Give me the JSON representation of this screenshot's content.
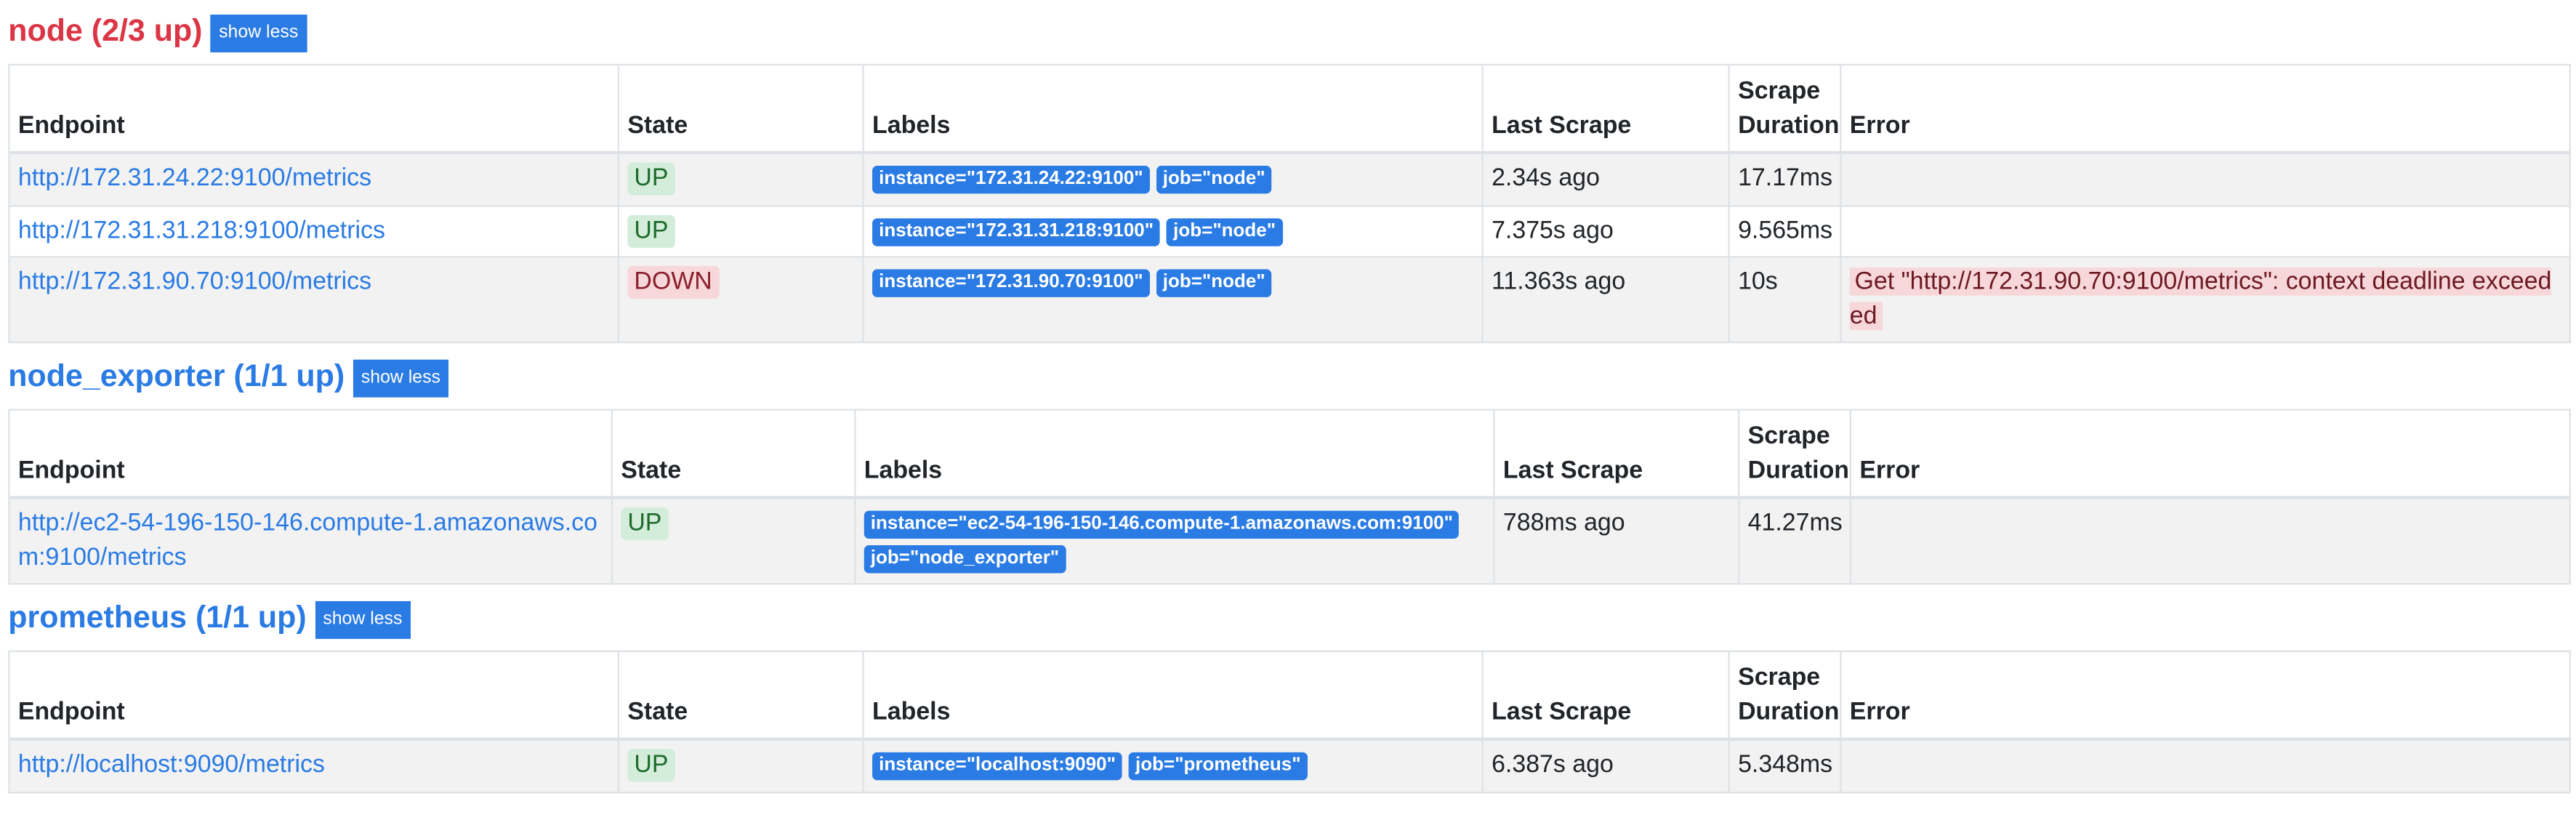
{
  "headers": {
    "endpoint": "Endpoint",
    "state": "State",
    "labels": "Labels",
    "last_scrape": "Last Scrape",
    "scrape_duration": "Scrape Duration",
    "error": "Error"
  },
  "jobs": [
    {
      "title": "node (2/3 up)",
      "button": "show less",
      "rows": [
        {
          "endpoint": "http://172.31.24.22:9100/metrics",
          "state": "UP",
          "labels": [
            "instance=\"172.31.24.22:9100\"",
            "job=\"node\""
          ],
          "last_scrape": "2.34s ago",
          "duration": "17.17ms",
          "error": ""
        },
        {
          "endpoint": "http://172.31.31.218:9100/metrics",
          "state": "UP",
          "labels": [
            "instance=\"172.31.31.218:9100\"",
            "job=\"node\""
          ],
          "last_scrape": "7.375s ago",
          "duration": "9.565ms",
          "error": ""
        },
        {
          "endpoint": "http://172.31.90.70:9100/metrics",
          "state": "DOWN",
          "labels": [
            "instance=\"172.31.90.70:9100\"",
            "job=\"node\""
          ],
          "last_scrape": "11.363s ago",
          "duration": "10s",
          "error": "Get \"http://172.31.90.70:9100/metrics\": context deadline exceeded"
        }
      ]
    },
    {
      "title": "node_exporter (1/1 up)",
      "button": "show less",
      "rows": [
        {
          "endpoint": "http://ec2-54-196-150-146.compute-1.amazonaws.com:9100/metrics",
          "state": "UP",
          "labels": [
            "instance=\"ec2-54-196-150-146.compute-1.amazonaws.com:9100\"",
            "job=\"node_exporter\""
          ],
          "last_scrape": "788ms ago",
          "duration": "41.27ms",
          "error": ""
        }
      ]
    },
    {
      "title": "prometheus (1/1 up)",
      "button": "show less",
      "rows": [
        {
          "endpoint": "http://localhost:9090/metrics",
          "state": "UP",
          "labels": [
            "instance=\"localhost:9090\"",
            "job=\"prometheus\""
          ],
          "last_scrape": "6.387s ago",
          "duration": "5.348ms",
          "error": ""
        }
      ]
    }
  ]
}
